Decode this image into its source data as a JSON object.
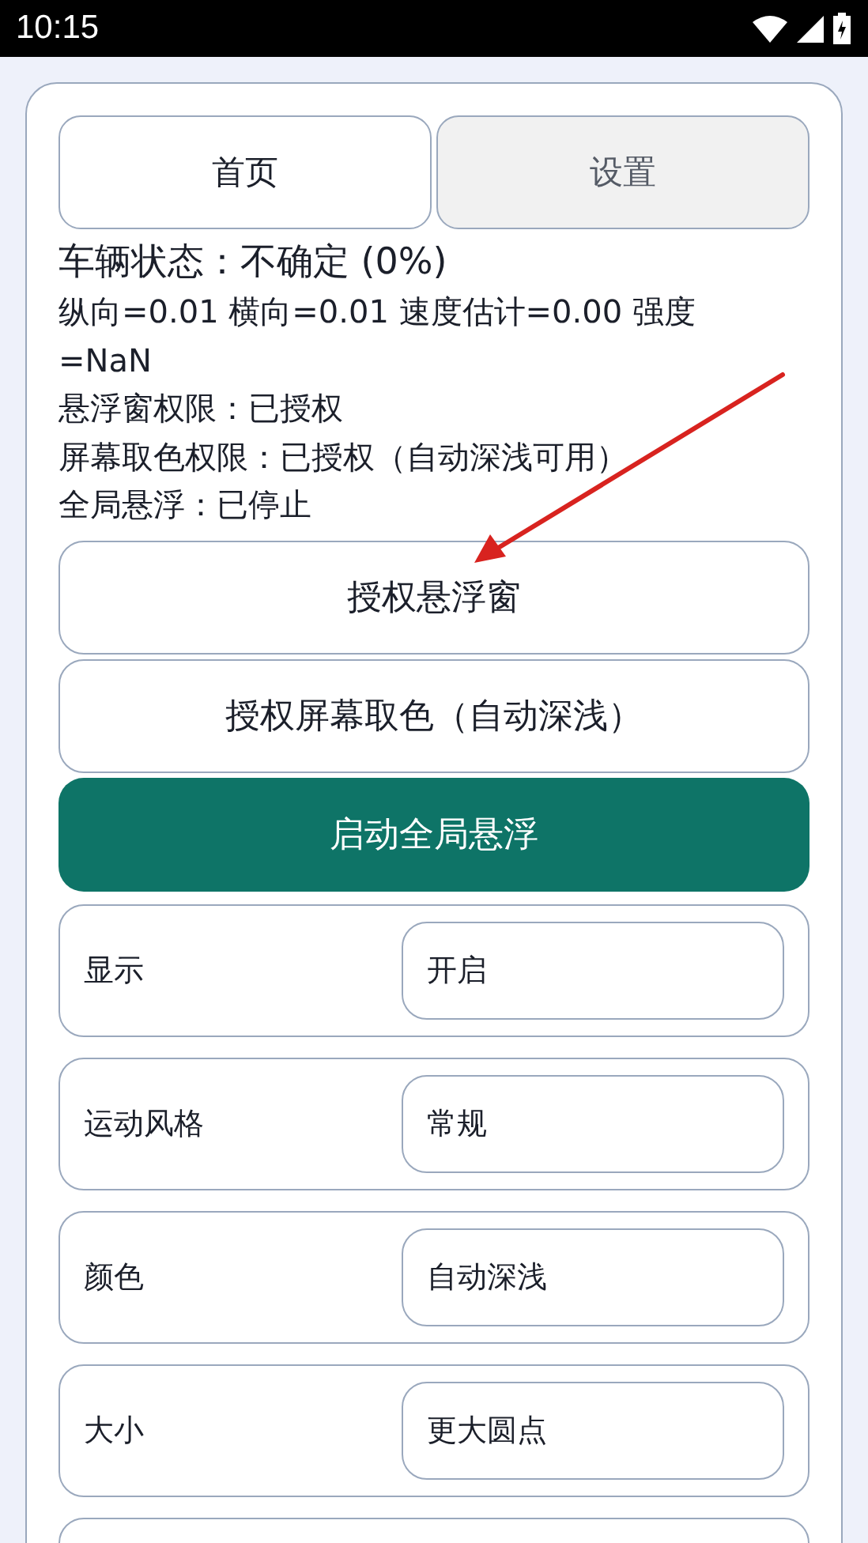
{
  "status_bar": {
    "time": "10:15"
  },
  "tabs": [
    {
      "label": "首页",
      "selected": true
    },
    {
      "label": "设置",
      "selected": false
    }
  ],
  "status_lines": [
    {
      "text": "车辆状态：不确定 (0%)",
      "kind": "heading"
    },
    {
      "text": "纵向=0.01 横向=0.01 速度估计=0.00 强度=NaN",
      "kind": "line"
    },
    {
      "text": "悬浮窗权限：已授权",
      "kind": "line"
    },
    {
      "text": "屏幕取色权限：已授权（自动深浅可用）",
      "kind": "line"
    },
    {
      "text": "全局悬浮：已停止",
      "kind": "line"
    }
  ],
  "buttons": [
    {
      "label": "授权悬浮窗",
      "kind": "outline"
    },
    {
      "label": "授权屏幕取色（自动深浅）",
      "kind": "outline"
    },
    {
      "label": "启动全局悬浮",
      "kind": "primary"
    }
  ],
  "settings": [
    {
      "label": "显示",
      "value": "开启"
    },
    {
      "label": "运动风格",
      "value": "常规"
    },
    {
      "label": "颜色",
      "value": "自动深浅"
    },
    {
      "label": "大小",
      "value": "更大圆点"
    }
  ],
  "annotation": {
    "kind": "arrow"
  }
}
